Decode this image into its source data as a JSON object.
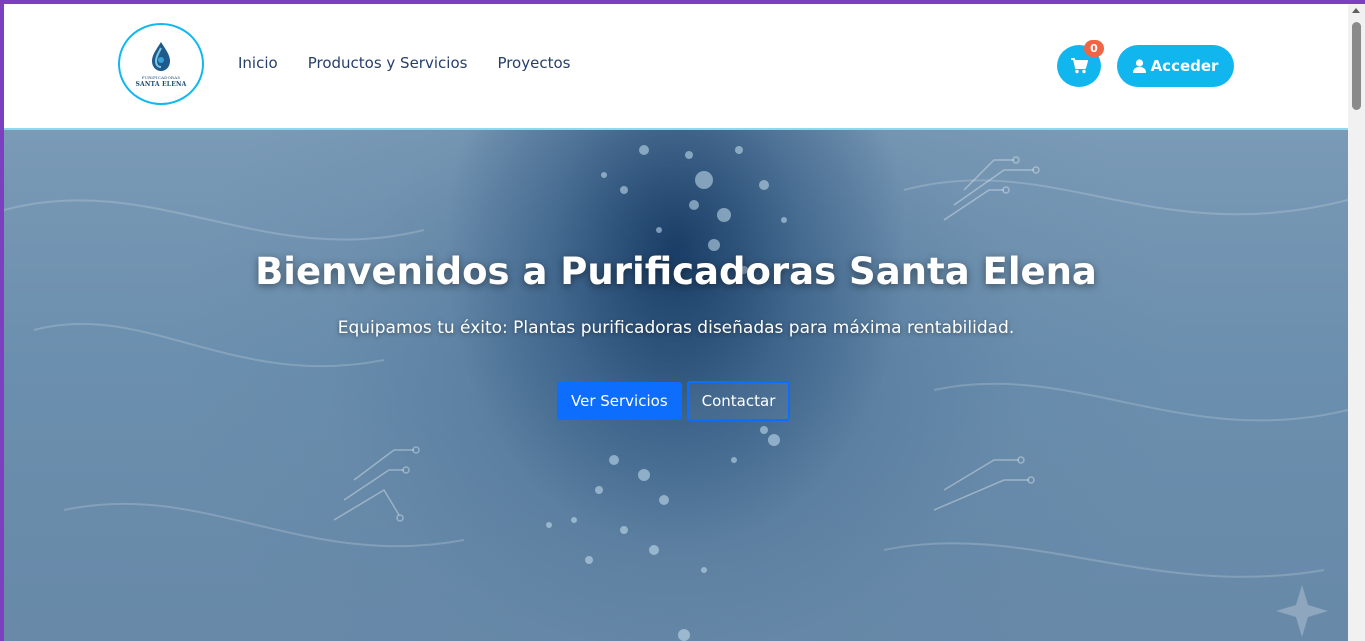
{
  "brand": {
    "logo_line1": "PURIFICADORAS",
    "logo_line2": "SANTA ELENA",
    "accent_color": "#11b6ef"
  },
  "nav": {
    "links": [
      {
        "label": "Inicio"
      },
      {
        "label": "Productos y Servicios"
      },
      {
        "label": "Proyectos"
      }
    ],
    "cart_count": "0",
    "cart_icon": "shopping-cart-icon",
    "login_icon": "user-icon",
    "login_label": "Acceder"
  },
  "hero": {
    "title": "Bienvenidos a Purificadoras Santa Elena",
    "subtitle": "Equipamos tu éxito: Plantas purificadoras diseñadas para máxima rentabilidad.",
    "primary_button": "Ver Servicios",
    "secondary_button": "Contactar",
    "primary_color": "#0d6efd"
  }
}
